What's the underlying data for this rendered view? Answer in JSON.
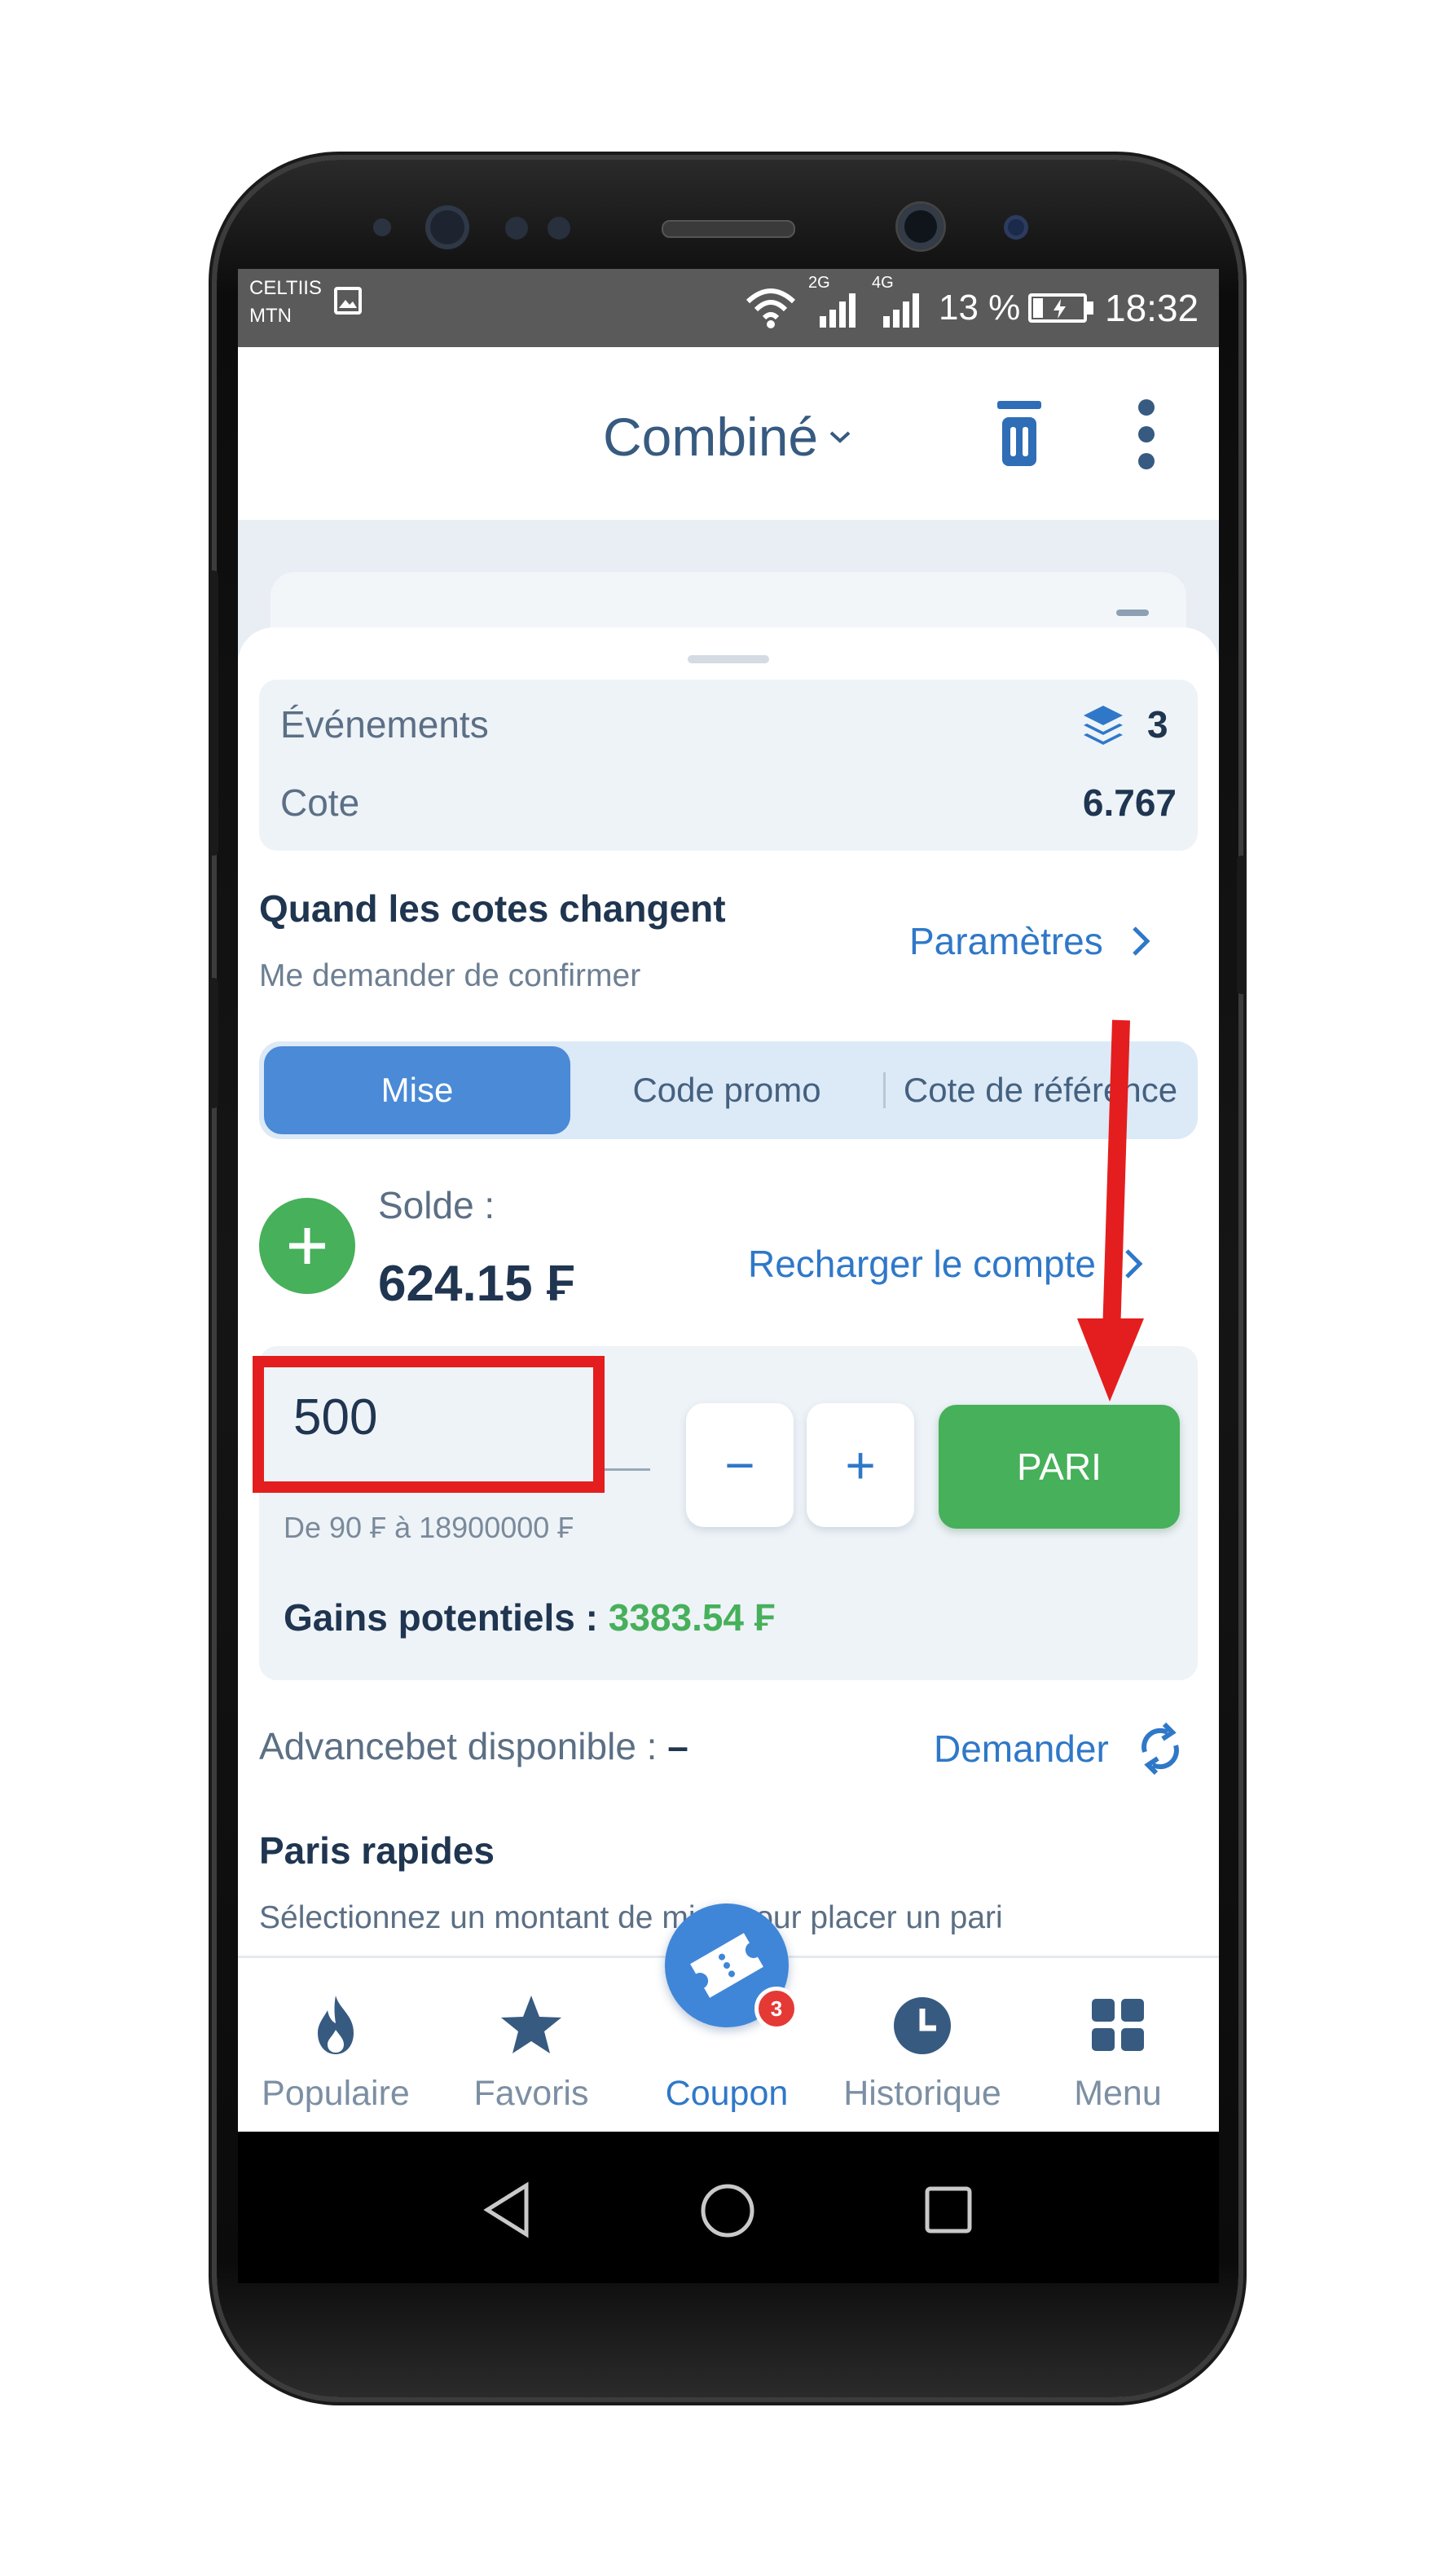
{
  "status_bar": {
    "carrier_line1": "CELTIIS",
    "carrier_line2": "MTN",
    "net_2g": "2G",
    "net_4g": "4G",
    "battery": "13 %",
    "time": "18:32"
  },
  "header": {
    "title": "Combiné"
  },
  "summary": {
    "events_label": "Événements",
    "events_count": "3",
    "odds_label": "Cote",
    "odds_value": "6.767"
  },
  "odds_change": {
    "title": "Quand les cotes changent",
    "subtitle": "Me demander de confirmer",
    "link": "Paramètres"
  },
  "tabs": [
    {
      "label": "Mise",
      "active": true
    },
    {
      "label": "Code promo",
      "active": false
    },
    {
      "label": "Cote de référence",
      "active": false
    }
  ],
  "balance": {
    "label": "Solde :",
    "value": "624.15 ₣",
    "recharge_link": "Recharger le compte"
  },
  "stake": {
    "value": "500",
    "range": "De 90 ₣ à 18900000 ₣",
    "minus": "−",
    "plus": "+",
    "bet_button": "PARI",
    "potential_label": "Gains potentiels :",
    "potential_value": "3383.54 ₣"
  },
  "advancebet": {
    "label": "Advancebet disponible :",
    "value": "–",
    "request_link": "Demander"
  },
  "quick_bets": {
    "title": "Paris rapides",
    "subtitle": "Sélectionnez un montant de mise pour placer un pari"
  },
  "bottom_nav": [
    {
      "label": "Populaire",
      "icon": "flame-icon"
    },
    {
      "label": "Favoris",
      "icon": "star-icon"
    },
    {
      "label": "Coupon",
      "icon": "ticket-icon",
      "badge": "3"
    },
    {
      "label": "Historique",
      "icon": "clock-icon"
    },
    {
      "label": "Menu",
      "icon": "grid-icon"
    }
  ],
  "colors": {
    "accent_blue": "#2f78c8",
    "green": "#46b05a",
    "annotation_red": "#e41e1e",
    "badge_red": "#e53935"
  }
}
